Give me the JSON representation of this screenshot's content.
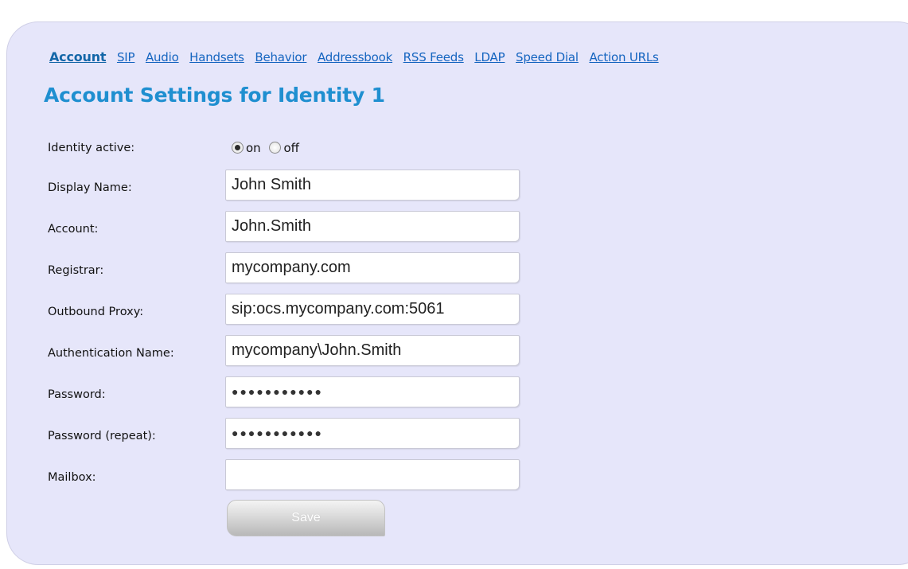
{
  "nav": {
    "tabs": [
      {
        "label": "Account",
        "active": true
      },
      {
        "label": "SIP"
      },
      {
        "label": "Audio"
      },
      {
        "label": "Handsets"
      },
      {
        "label": "Behavior"
      },
      {
        "label": "Addressbook"
      },
      {
        "label": "RSS Feeds"
      },
      {
        "label": "LDAP"
      },
      {
        "label": "Speed Dial"
      },
      {
        "label": "Action URLs"
      }
    ]
  },
  "page": {
    "title": "Account Settings for Identity 1"
  },
  "form": {
    "identity_active": {
      "label": "Identity active:",
      "options": [
        "on",
        "off"
      ],
      "selected": "on"
    },
    "display_name": {
      "label": "Display Name:",
      "value": "John Smith"
    },
    "account": {
      "label": "Account:",
      "value": "John.Smith"
    },
    "registrar": {
      "label": "Registrar:",
      "value": "mycompany.com"
    },
    "outbound_proxy": {
      "label": "Outbound Proxy:",
      "value": "sip:ocs.mycompany.com:5061"
    },
    "auth_name": {
      "label": "Authentication Name:",
      "value": "mycompany\\John.Smith"
    },
    "password": {
      "label": "Password:",
      "value": "●●●●●●●●●●●"
    },
    "password_repeat": {
      "label": "Password (repeat):",
      "value": "●●●●●●●●●●●"
    },
    "mailbox": {
      "label": "Mailbox:",
      "value": ""
    },
    "save_label": "Save"
  },
  "colors": {
    "panel_bg": "#e6e6fa",
    "link": "#1565c0",
    "title": "#1f8fd0"
  }
}
